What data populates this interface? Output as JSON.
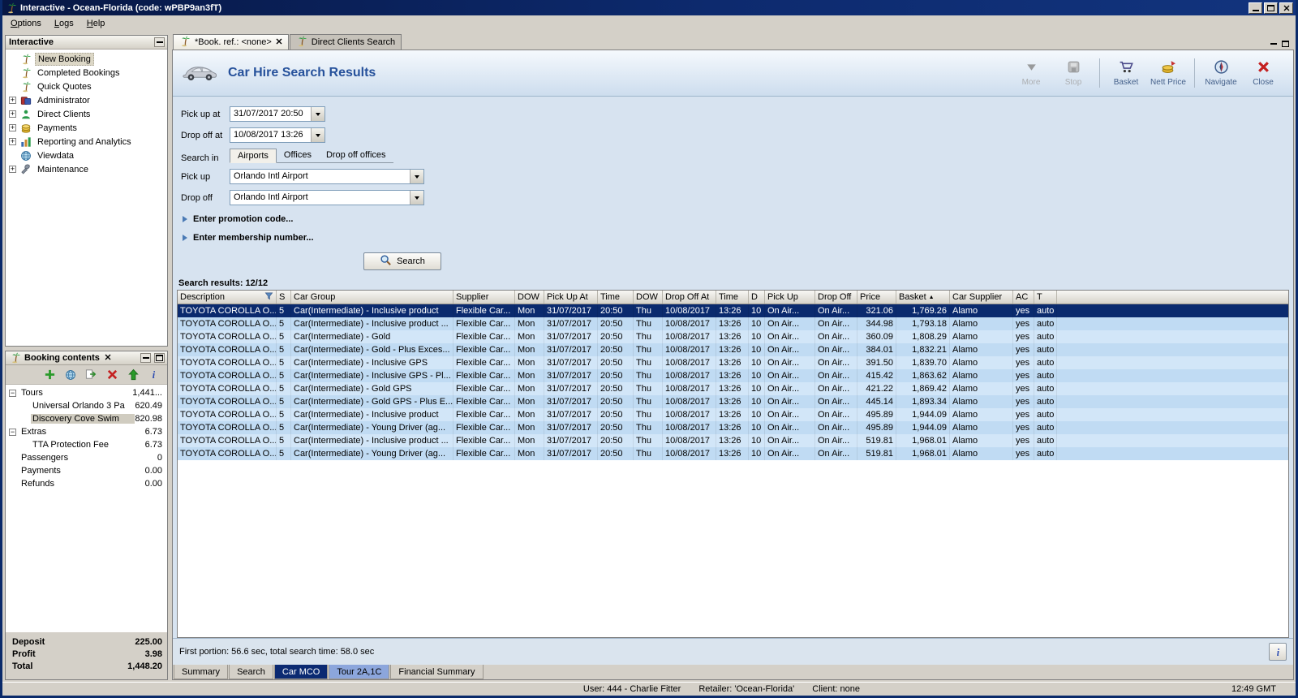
{
  "window": {
    "title": "Interactive - Ocean-Florida (code: wPBP9an3fT)",
    "menu_items": [
      "Options",
      "Logs",
      "Help"
    ],
    "status_bar": {
      "user": "User: 444 - Charlie Fitter",
      "retailer": "Retailer: 'Ocean-Florida'",
      "client": "Client: none",
      "time": "12:49 GMT"
    }
  },
  "sidebar": {
    "title": "Interactive",
    "items": [
      {
        "label": "New Booking",
        "icon": "palm",
        "expandable": false,
        "selected": true
      },
      {
        "label": "Completed Bookings",
        "icon": "palm",
        "expandable": false,
        "selected": false
      },
      {
        "label": "Quick Quotes",
        "icon": "palm",
        "expandable": false,
        "selected": false
      },
      {
        "label": "Administrator",
        "icon": "admin",
        "expandable": true,
        "selected": false
      },
      {
        "label": "Direct Clients",
        "icon": "clients",
        "expandable": true,
        "selected": false
      },
      {
        "label": "Payments",
        "icon": "payments",
        "expandable": true,
        "selected": false
      },
      {
        "label": "Reporting and Analytics",
        "icon": "reporting",
        "expandable": true,
        "selected": false
      },
      {
        "label": "Viewdata",
        "icon": "globe",
        "expandable": false,
        "selected": false
      },
      {
        "label": "Maintenance",
        "icon": "maintenance",
        "expandable": true,
        "selected": false
      }
    ]
  },
  "booking_contents": {
    "title": "Booking contents",
    "toolbar": [
      {
        "name": "add-item",
        "icon": "plus"
      },
      {
        "name": "world",
        "icon": "globe"
      },
      {
        "name": "transfer-item",
        "icon": "transfer"
      },
      {
        "name": "delete-item",
        "icon": "delete"
      },
      {
        "name": "move-up",
        "icon": "up"
      },
      {
        "name": "item-info",
        "icon": "info"
      }
    ],
    "tree": [
      {
        "label": "Tours",
        "value": "1,441...",
        "level": 0,
        "expander": true,
        "selected": false
      },
      {
        "label": "Universal Orlando 3 Pa",
        "value": "620.49",
        "level": 1,
        "expander": false,
        "selected": false
      },
      {
        "label": "Discovery Cove  Swim",
        "value": "820.98",
        "level": 1,
        "expander": false,
        "selected": true
      },
      {
        "label": "Extras",
        "value": "6.73",
        "level": 0,
        "expander": true,
        "selected": false
      },
      {
        "label": "TTA Protection Fee",
        "value": "6.73",
        "level": 1,
        "expander": false,
        "selected": false
      },
      {
        "label": "Passengers",
        "value": "0",
        "level": 0,
        "expander": false,
        "selected": false
      },
      {
        "label": "Payments",
        "value": "0.00",
        "level": 0,
        "expander": false,
        "selected": false
      },
      {
        "label": "Refunds",
        "value": "0.00",
        "level": 0,
        "expander": false,
        "selected": false
      }
    ],
    "summary": [
      {
        "label": "Deposit",
        "value": "225.00"
      },
      {
        "label": "Profit",
        "value": "3.98"
      },
      {
        "label": "Total",
        "value": "1,448.20"
      }
    ]
  },
  "document_tabs": [
    {
      "label": "*Book. ref.: <none>",
      "active": true,
      "closable": true
    },
    {
      "label": "Direct Clients Search",
      "active": false,
      "closable": false
    }
  ],
  "car_hire": {
    "title": "Car Hire Search Results",
    "toolbar": [
      {
        "label": "More",
        "icon": "more",
        "disabled": true,
        "group_start": false
      },
      {
        "label": "Stop",
        "icon": "stop",
        "disabled": true,
        "group_start": false
      },
      {
        "label": "Basket",
        "icon": "cart",
        "disabled": false,
        "group_start": true
      },
      {
        "label": "Nett Price",
        "icon": "coins",
        "disabled": false,
        "group_start": false
      },
      {
        "label": "Navigate",
        "icon": "navigate",
        "disabled": false,
        "group_start": true
      },
      {
        "label": "Close",
        "icon": "close",
        "disabled": false,
        "group_start": false
      }
    ],
    "form": {
      "pickup_at": {
        "label": "Pick up at",
        "value": "31/07/2017 20:50"
      },
      "dropoff_at": {
        "label": "Drop off at",
        "value": "10/08/2017 13:26"
      },
      "search_in_label": "Search in",
      "search_in_tabs": [
        {
          "label": "Airports",
          "active": true
        },
        {
          "label": "Offices",
          "active": false
        },
        {
          "label": "Drop off offices",
          "active": false
        }
      ],
      "pickup": {
        "label": "Pick up",
        "value": "Orlando Intl Airport"
      },
      "dropoff": {
        "label": "Drop off",
        "value": "Orlando Intl Airport"
      },
      "promotion_toggle": "Enter promotion code...",
      "membership_toggle": "Enter membership number...",
      "search_button": "Search"
    },
    "results_label": "Search results: 12/12",
    "results_table": {
      "columns": [
        "Description",
        "S",
        "Car Group",
        "Supplier",
        "DOW",
        "Pick Up At",
        "Time",
        "DOW",
        "Drop Off At",
        "Time",
        "D",
        "Pick Up",
        "Drop Off",
        "Price",
        "Basket",
        "Car Supplier",
        "AC",
        "T"
      ],
      "sorted_column": "Basket",
      "selected_row": 0,
      "rows": [
        [
          "TOYOTA COROLLA O...",
          "5",
          "Car(Intermediate) - Inclusive product",
          "Flexible Car...",
          "Mon",
          "31/07/2017",
          "20:50",
          "Thu",
          "10/08/2017",
          "13:26",
          "10",
          "On Air...",
          "On Air...",
          "321.06",
          "1,769.26",
          "Alamo",
          "yes",
          "auto"
        ],
        [
          "TOYOTA COROLLA O...",
          "5",
          "Car(Intermediate) - Inclusive product ...",
          "Flexible Car...",
          "Mon",
          "31/07/2017",
          "20:50",
          "Thu",
          "10/08/2017",
          "13:26",
          "10",
          "On Air...",
          "On Air...",
          "344.98",
          "1,793.18",
          "Alamo",
          "yes",
          "auto"
        ],
        [
          "TOYOTA COROLLA O...",
          "5",
          "Car(Intermediate) - Gold",
          "Flexible Car...",
          "Mon",
          "31/07/2017",
          "20:50",
          "Thu",
          "10/08/2017",
          "13:26",
          "10",
          "On Air...",
          "On Air...",
          "360.09",
          "1,808.29",
          "Alamo",
          "yes",
          "auto"
        ],
        [
          "TOYOTA COROLLA O...",
          "5",
          "Car(Intermediate) - Gold - Plus Exces...",
          "Flexible Car...",
          "Mon",
          "31/07/2017",
          "20:50",
          "Thu",
          "10/08/2017",
          "13:26",
          "10",
          "On Air...",
          "On Air...",
          "384.01",
          "1,832.21",
          "Alamo",
          "yes",
          "auto"
        ],
        [
          "TOYOTA COROLLA O...",
          "5",
          "Car(Intermediate) - Inclusive GPS",
          "Flexible Car...",
          "Mon",
          "31/07/2017",
          "20:50",
          "Thu",
          "10/08/2017",
          "13:26",
          "10",
          "On Air...",
          "On Air...",
          "391.50",
          "1,839.70",
          "Alamo",
          "yes",
          "auto"
        ],
        [
          "TOYOTA COROLLA O...",
          "5",
          "Car(Intermediate) - Inclusive GPS - Pl...",
          "Flexible Car...",
          "Mon",
          "31/07/2017",
          "20:50",
          "Thu",
          "10/08/2017",
          "13:26",
          "10",
          "On Air...",
          "On Air...",
          "415.42",
          "1,863.62",
          "Alamo",
          "yes",
          "auto"
        ],
        [
          "TOYOTA COROLLA O...",
          "5",
          "Car(Intermediate) - Gold GPS",
          "Flexible Car...",
          "Mon",
          "31/07/2017",
          "20:50",
          "Thu",
          "10/08/2017",
          "13:26",
          "10",
          "On Air...",
          "On Air...",
          "421.22",
          "1,869.42",
          "Alamo",
          "yes",
          "auto"
        ],
        [
          "TOYOTA COROLLA O...",
          "5",
          "Car(Intermediate) - Gold GPS - Plus E...",
          "Flexible Car...",
          "Mon",
          "31/07/2017",
          "20:50",
          "Thu",
          "10/08/2017",
          "13:26",
          "10",
          "On Air...",
          "On Air...",
          "445.14",
          "1,893.34",
          "Alamo",
          "yes",
          "auto"
        ],
        [
          "TOYOTA COROLLA O...",
          "5",
          "Car(Intermediate) - Inclusive product",
          "Flexible Car...",
          "Mon",
          "31/07/2017",
          "20:50",
          "Thu",
          "10/08/2017",
          "13:26",
          "10",
          "On Air...",
          "On Air...",
          "495.89",
          "1,944.09",
          "Alamo",
          "yes",
          "auto"
        ],
        [
          "TOYOTA COROLLA O...",
          "5",
          "Car(Intermediate) - Young Driver (ag...",
          "Flexible Car...",
          "Mon",
          "31/07/2017",
          "20:50",
          "Thu",
          "10/08/2017",
          "13:26",
          "10",
          "On Air...",
          "On Air...",
          "495.89",
          "1,944.09",
          "Alamo",
          "yes",
          "auto"
        ],
        [
          "TOYOTA COROLLA O...",
          "5",
          "Car(Intermediate) - Inclusive product ...",
          "Flexible Car...",
          "Mon",
          "31/07/2017",
          "20:50",
          "Thu",
          "10/08/2017",
          "13:26",
          "10",
          "On Air...",
          "On Air...",
          "519.81",
          "1,968.01",
          "Alamo",
          "yes",
          "auto"
        ],
        [
          "TOYOTA COROLLA O...",
          "5",
          "Car(Intermediate) - Young Driver (ag...",
          "Flexible Car...",
          "Mon",
          "31/07/2017",
          "20:50",
          "Thu",
          "10/08/2017",
          "13:26",
          "10",
          "On Air...",
          "On Air...",
          "519.81",
          "1,968.01",
          "Alamo",
          "yes",
          "auto"
        ]
      ]
    },
    "status_text": "First portion: 56.6 sec, total search time: 58.0 sec",
    "view_tabs": [
      {
        "label": "Summary",
        "state": "normal"
      },
      {
        "label": "Search",
        "state": "normal"
      },
      {
        "label": "Car MCO",
        "state": "active"
      },
      {
        "label": "Tour 2A,1C",
        "state": "highlighted"
      },
      {
        "label": "Financial Summary",
        "state": "normal"
      }
    ]
  }
}
